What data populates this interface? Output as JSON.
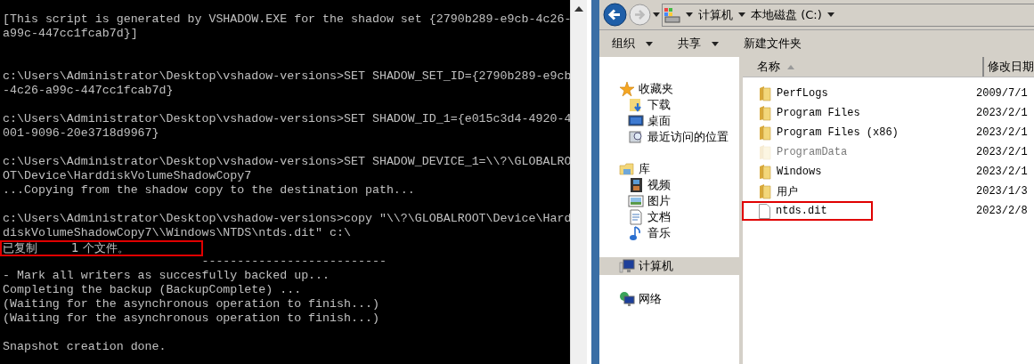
{
  "console": {
    "lines": [
      {
        "kind": "text",
        "text": "[This script is generated by VSHADOW.EXE for the shadow set {2790b289-e9cb-4c26-",
        "highlighted": false
      },
      {
        "kind": "text",
        "text": "a99c-447cc1fcab7d}]",
        "highlighted": false
      },
      {
        "kind": "blank"
      },
      {
        "kind": "blank"
      },
      {
        "kind": "text",
        "text": "c:\\Users\\Administrator\\Desktop\\vshadow-versions>SET SHADOW_SET_ID={2790b289-e9cb",
        "highlighted": false
      },
      {
        "kind": "text",
        "text": "-4c26-a99c-447cc1fcab7d}",
        "highlighted": false
      },
      {
        "kind": "blank"
      },
      {
        "kind": "text",
        "text": "c:\\Users\\Administrator\\Desktop\\vshadow-versions>SET SHADOW_ID_1={e015c3d4-4920-4",
        "highlighted": false
      },
      {
        "kind": "text",
        "text": "001-9096-20e3718d9967}",
        "highlighted": false
      },
      {
        "kind": "blank"
      },
      {
        "kind": "text",
        "text": "c:\\Users\\Administrator\\Desktop\\vshadow-versions>SET SHADOW_DEVICE_1=\\\\?\\GLOBALRO",
        "highlighted": false
      },
      {
        "kind": "text",
        "text": "OT\\Device\\HarddiskVolumeShadowCopy7",
        "highlighted": false
      },
      {
        "kind": "text",
        "text": "...Copying from the shadow copy to the destination path...",
        "highlighted": false
      },
      {
        "kind": "blank"
      },
      {
        "kind": "text",
        "text": "c:\\Users\\Administrator\\Desktop\\vshadow-versions>copy \"\\\\?\\GLOBALROOT\\Device\\Hard",
        "highlighted": false
      },
      {
        "kind": "text",
        "text": "diskVolumeShadowCopy7\\\\Windows\\NTDS\\ntds.dit\" c:\\",
        "highlighted": false
      },
      {
        "kind": "text",
        "text": "已复制         1 个文件。",
        "highlighted": true
      },
      {
        "kind": "text",
        "text": "                            --------------------------",
        "highlighted": false
      },
      {
        "kind": "text",
        "text": "- Mark all writers as succesfully backed up...",
        "highlighted": false
      },
      {
        "kind": "text",
        "text": "Completing the backup (BackupComplete) ...",
        "highlighted": false
      },
      {
        "kind": "text",
        "text": "(Waiting for the asynchronous operation to finish...)",
        "highlighted": false
      },
      {
        "kind": "text",
        "text": "(Waiting for the asynchronous operation to finish...)",
        "highlighted": false
      },
      {
        "kind": "blank"
      },
      {
        "kind": "text",
        "text": "Snapshot creation done.",
        "highlighted": false
      }
    ]
  },
  "explorer": {
    "address": [
      "计算机",
      "本地磁盘 (C:)"
    ],
    "toolbar": [
      {
        "label": "组织",
        "menu": true
      },
      {
        "label": "共享",
        "menu": true
      },
      {
        "label": "新建文件夹",
        "menu": false
      }
    ],
    "sidebar": {
      "items": [
        {
          "label": "收藏夹",
          "kind": "star",
          "selected": false,
          "children": [
            {
              "label": "下载",
              "kind": "download",
              "selected": false
            },
            {
              "label": "桌面",
              "kind": "desktop",
              "selected": false
            },
            {
              "label": "最近访问的位置",
              "kind": "recent",
              "selected": false
            }
          ]
        },
        {
          "label": "库",
          "kind": "library",
          "selected": false,
          "children": [
            {
              "label": "视频",
              "kind": "video",
              "selected": false
            },
            {
              "label": "图片",
              "kind": "image",
              "selected": false
            },
            {
              "label": "文档",
              "kind": "document",
              "selected": false
            },
            {
              "label": "音乐",
              "kind": "music",
              "selected": false
            }
          ]
        },
        {
          "label": "计算机",
          "kind": "computer",
          "selected": true
        },
        {
          "label": "网络",
          "kind": "network",
          "selected": false
        }
      ]
    },
    "table": {
      "columns": [
        "名称",
        "修改日期"
      ],
      "rows": [
        {
          "kind": "folder",
          "name": "PerfLogs",
          "date": "2009/7/1",
          "hidden": false,
          "highlighted": false
        },
        {
          "kind": "folder",
          "name": "Program Files",
          "date": "2023/2/1",
          "hidden": false,
          "highlighted": false
        },
        {
          "kind": "folder",
          "name": "Program Files (x86)",
          "date": "2023/2/1",
          "hidden": false,
          "highlighted": false
        },
        {
          "kind": "folder",
          "name": "ProgramData",
          "date": "2023/2/1",
          "hidden": true,
          "highlighted": false
        },
        {
          "kind": "folder",
          "name": "Windows",
          "date": "2023/2/1",
          "hidden": false,
          "highlighted": false
        },
        {
          "kind": "folder",
          "name": "用户",
          "date": "2023/1/3",
          "hidden": false,
          "highlighted": false
        },
        {
          "kind": "file",
          "name": "ntds.dit",
          "date": "2023/2/8",
          "hidden": false,
          "highlighted": true
        }
      ]
    }
  }
}
